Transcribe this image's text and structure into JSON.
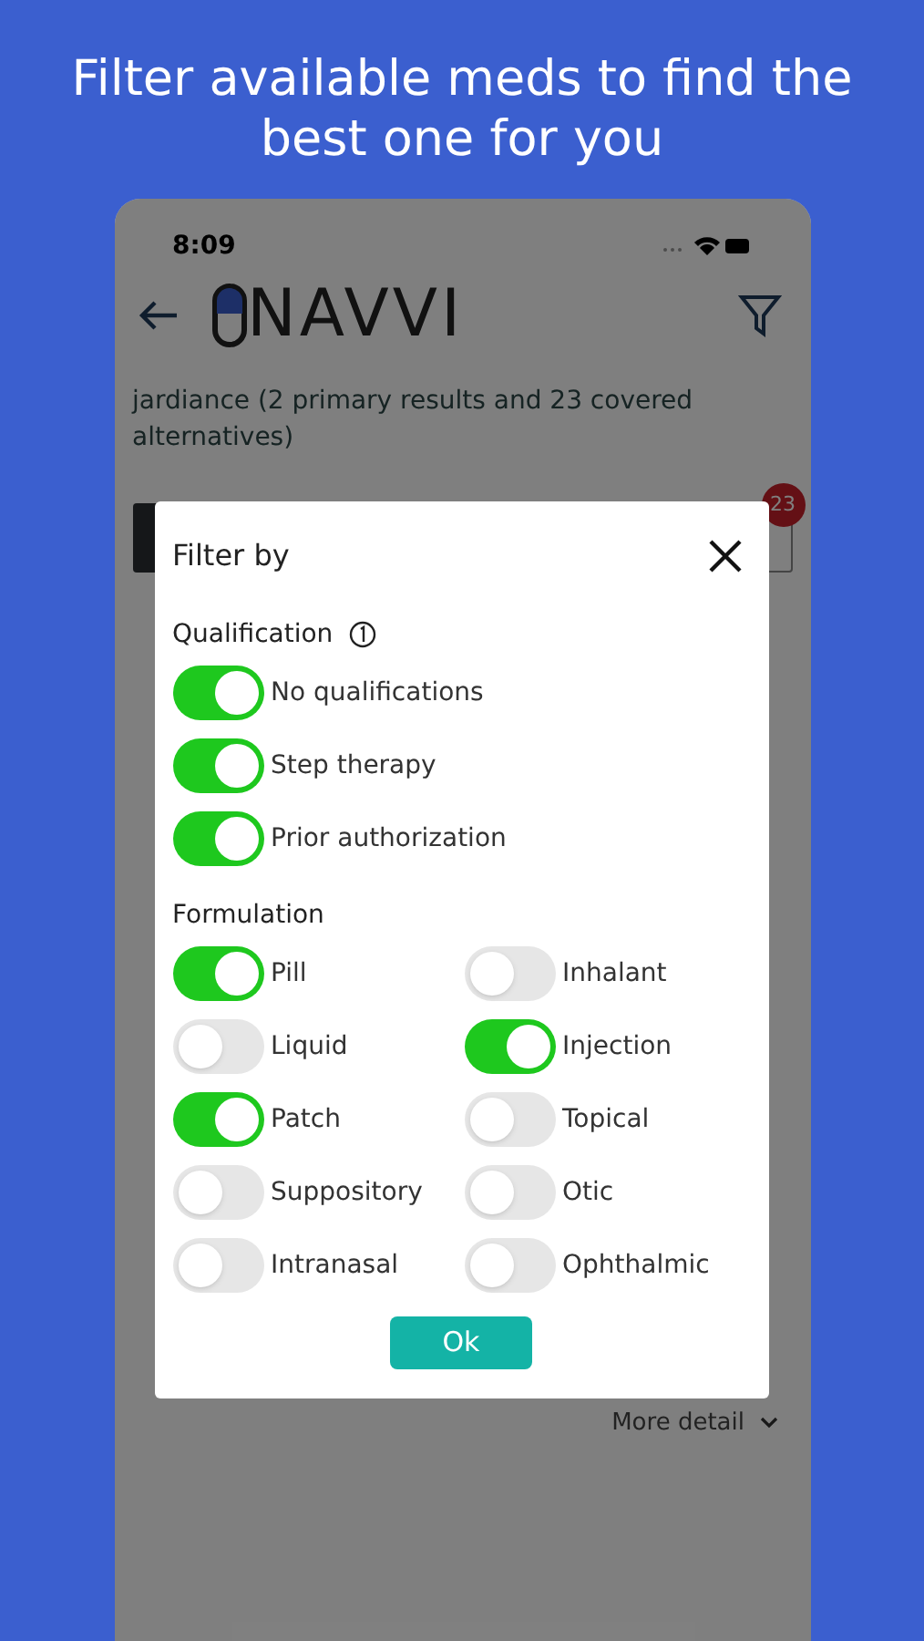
{
  "headline": "Filter available meds to find the best one for you",
  "status_bar": {
    "time": "8:09"
  },
  "app_bar": {
    "logo": "NAVVI"
  },
  "search_summary": "jardiance (2 primary results and 23 covered alternatives)",
  "tabs": [
    {
      "selected": true
    },
    {
      "selected": false,
      "badge": "23"
    }
  ],
  "more_detail": "More detail",
  "dialog": {
    "title": "Filter by",
    "sections": [
      {
        "title": "Qualification",
        "kind": "list",
        "items": [
          {
            "label": "No qualifications",
            "on": true
          },
          {
            "label": "Step therapy",
            "on": true
          },
          {
            "label": "Prior authorization",
            "on": true
          }
        ]
      },
      {
        "title": "Formulation",
        "kind": "grid",
        "items": [
          {
            "label": "Pill",
            "on": true
          },
          {
            "label": "Inhalant",
            "on": false
          },
          {
            "label": "Liquid",
            "on": false
          },
          {
            "label": "Injection",
            "on": true
          },
          {
            "label": "Patch",
            "on": true
          },
          {
            "label": "Topical",
            "on": false
          },
          {
            "label": "Suppository",
            "on": false
          },
          {
            "label": "Otic",
            "on": false
          },
          {
            "label": "Intranasal",
            "on": false
          },
          {
            "label": "Ophthalmic",
            "on": false
          }
        ]
      }
    ],
    "ok_button": "Ok"
  }
}
